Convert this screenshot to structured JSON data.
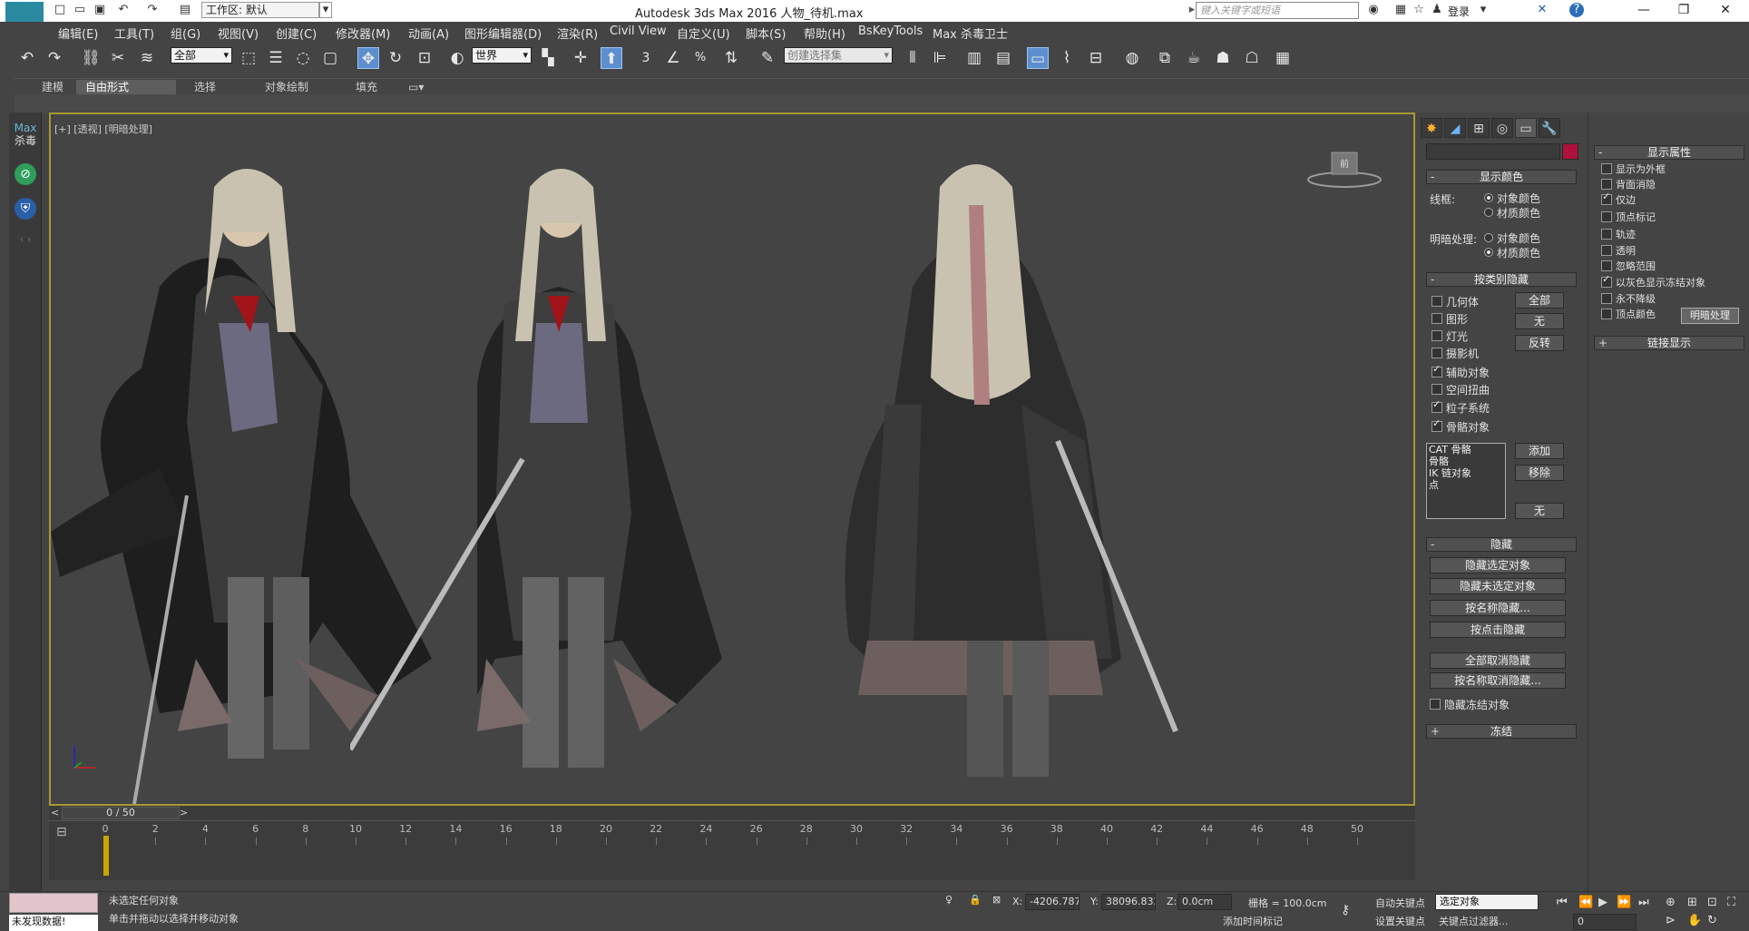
{
  "app": {
    "logo": "MAX",
    "title": "Autodesk 3ds Max 2016      人物_待机.max",
    "workspace": "工作区: 默认",
    "search_placeholder": "键入关键字或短语",
    "login": "登录"
  },
  "menus": [
    "编辑(E)",
    "工具(T)",
    "组(G)",
    "视图(V)",
    "创建(C)",
    "修改器(M)",
    "动画(A)",
    "图形编辑器(D)",
    "渲染(R)",
    "Civil View",
    "自定义(U)",
    "脚本(S)",
    "帮助(H)",
    "BsKeyTools",
    "Max 杀毒卫士"
  ],
  "toolbar": {
    "selection_filter": "全部",
    "ref_coord": "世界",
    "snap_label": "3",
    "named_selection": "创建选择集"
  },
  "ribbon_tabs": [
    "建模",
    "自由形式",
    "选择",
    "对象绘制",
    "填充"
  ],
  "sidebar": {
    "max_label_1": "Max",
    "max_label_2": "杀毒"
  },
  "viewport": {
    "label": "[+] [透视] [明暗处理]",
    "viewcube_label": "前"
  },
  "time_slider": {
    "frame_display": "0 / 50",
    "left_arrow": "<",
    "right_arrow": ">"
  },
  "timeline_ticks": [
    "0",
    "2",
    "4",
    "6",
    "8",
    "10",
    "12",
    "14",
    "16",
    "18",
    "20",
    "22",
    "24",
    "26",
    "28",
    "30",
    "32",
    "34",
    "36",
    "38",
    "40",
    "42",
    "44",
    "46",
    "48",
    "50"
  ],
  "status": {
    "no_data": "未发现数据!",
    "selection_msg": "未选定任何对象",
    "prompt_msg": "单击并拖动以选择并移动对象",
    "x_label": "X:",
    "x_value": "-4206.787c",
    "y_label": "Y:",
    "y_value": "38096.832",
    "z_label": "Z:",
    "z_value": "0.0cm",
    "grid": "栅格 = 100.0cm",
    "auto_key": "自动关键点",
    "selected_objects": "选定对象",
    "set_key": "设置关键点",
    "key_filters": "关键点过滤器...",
    "frame_field": "0",
    "add_time_tag": "添加时间标记"
  },
  "display_color": {
    "title": "显示颜色",
    "wireframe_label": "线框:",
    "shaded_label": "明暗处理:",
    "object_color": "对象颜色",
    "material_color": "材质颜色"
  },
  "hide_by_category": {
    "title": "按类别隐藏",
    "items": [
      {
        "label": "几何体",
        "checked": false
      },
      {
        "label": "图形",
        "checked": false
      },
      {
        "label": "灯光",
        "checked": false
      },
      {
        "label": "摄影机",
        "checked": false
      },
      {
        "label": "辅助对象",
        "checked": true
      },
      {
        "label": "空间扭曲",
        "checked": false
      },
      {
        "label": "粒子系统",
        "checked": true
      },
      {
        "label": "骨骼对象",
        "checked": true
      }
    ],
    "all": "全部",
    "none": "无",
    "invert": "反转",
    "list": [
      "CAT 骨骼",
      "骨骼",
      "IK 链对象",
      "点"
    ],
    "add": "添加",
    "remove": "移除",
    "none2": "无"
  },
  "hide": {
    "title": "隐藏",
    "buttons": [
      "隐藏选定对象",
      "隐藏未选定对象",
      "按名称隐藏...",
      "按点击隐藏",
      "全部取消隐藏",
      "按名称取消隐藏..."
    ],
    "hide_frozen": "隐藏冻结对象"
  },
  "freeze": {
    "title": "冻结"
  },
  "display_props": {
    "title": "显示属性",
    "items": [
      {
        "label": "显示为外框",
        "checked": false
      },
      {
        "label": "背面消隐",
        "checked": false
      },
      {
        "label": "仅边",
        "checked": true
      },
      {
        "label": "顶点标记",
        "checked": false
      },
      {
        "label": "轨迹",
        "checked": false
      },
      {
        "label": "透明",
        "checked": false
      },
      {
        "label": "忽略范围",
        "checked": false
      },
      {
        "label": "以灰色显示冻结对象",
        "checked": true
      },
      {
        "label": "永不降级",
        "checked": false
      },
      {
        "label": "顶点颜色",
        "checked": false
      }
    ],
    "shaded_button": "明暗处理",
    "link_display": "链接显示"
  },
  "colors": {
    "accent_blue": "#5d8fd0",
    "viewport_border": "#a89a32",
    "object_color_swatch": "#b0103c",
    "key_marker": "#c8a800"
  }
}
